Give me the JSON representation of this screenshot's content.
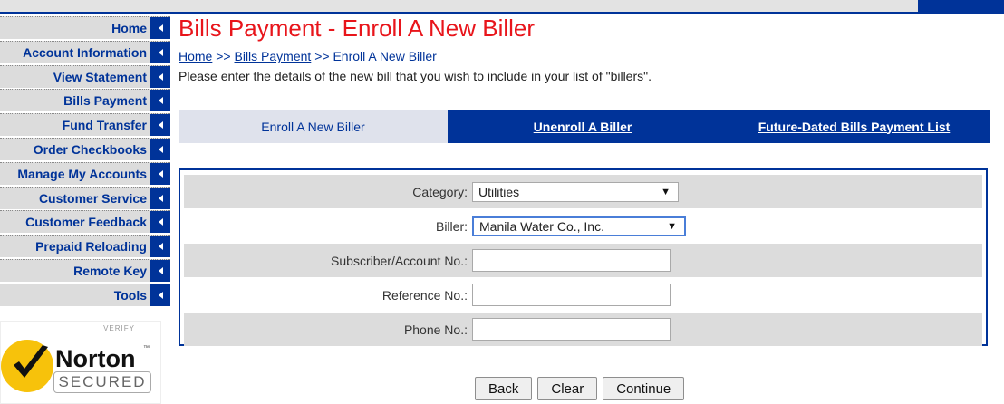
{
  "sidebar": {
    "items": [
      {
        "label": "Home"
      },
      {
        "label": "Account Information"
      },
      {
        "label": "View Statement"
      },
      {
        "label": "Bills Payment"
      },
      {
        "label": "Fund Transfer"
      },
      {
        "label": "Order Checkbooks"
      },
      {
        "label": "Manage My Accounts"
      },
      {
        "label": "Customer Service"
      },
      {
        "label": "Customer Feedback"
      },
      {
        "label": "Prepaid Reloading"
      },
      {
        "label": "Remote Key"
      },
      {
        "label": "Tools"
      }
    ],
    "badge": {
      "verify": "VERIFY",
      "name": "Norton",
      "tm": "™",
      "secured": "SECURED"
    }
  },
  "page": {
    "title": "Bills Payment - Enroll A New Biller",
    "breadcrumb": {
      "home": "Home",
      "sep1": " >> ",
      "bills": "Bills Payment",
      "sep2": " >> ",
      "current": "Enroll A New Biller"
    },
    "instructions": "Please enter the details of the new bill that you wish to include in your list of \"billers\"."
  },
  "tabs": [
    {
      "label": "Enroll A New Biller"
    },
    {
      "label": "Unenroll A Biller"
    },
    {
      "label": "Future-Dated Bills Payment List"
    }
  ],
  "form": {
    "category_label": "Category:",
    "category_value": "Utilities",
    "biller_label": "Biller:",
    "biller_value": "Manila Water Co., Inc.",
    "subscriber_label": "Subscriber/Account No.:",
    "subscriber_value": "",
    "reference_label": "Reference No.:",
    "reference_value": "",
    "phone_label": "Phone No.:",
    "phone_value": "",
    "dropdown_arrow": "▼"
  },
  "buttons": {
    "back": "Back",
    "clear": "Clear",
    "continue": "Continue"
  },
  "colors": {
    "brand_blue": "#003399",
    "title_red": "#e8151b",
    "active_tab": "#dfe2ec",
    "row_shade": "#dcdcdc"
  }
}
